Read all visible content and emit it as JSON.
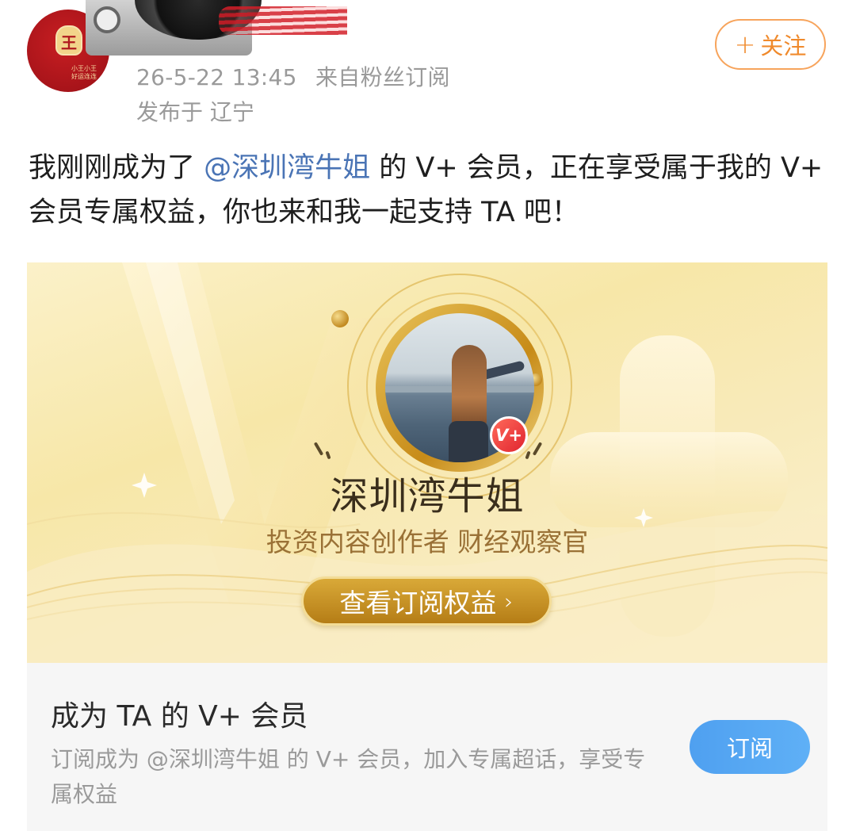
{
  "header": {
    "timestamp": "26-5-22 13:45",
    "source": "来自粉丝订阅",
    "location": "发布于 辽宁",
    "follow_plus": "+",
    "follow_label": "关注",
    "avatar_badge": "王",
    "avatar_tiny_text": "小王小王 好运连连"
  },
  "post": {
    "text_before": "我刚刚成为了",
    "mention": "@深圳湾牛姐",
    "text_after": " 的 V+ 会员，正在享受属于我的 V+ 会员专属权益，你也来和我一起支持 TA 吧！"
  },
  "card": {
    "vplus_badge": "V+",
    "name": "深圳湾牛姐",
    "description": "投资内容创作者 财经观察官",
    "button_label": "查看订阅权益",
    "button_chevron": "›"
  },
  "footer": {
    "title": "成为 TA 的 V+ 会员",
    "description": "订阅成为 @深圳湾牛姐 的 V+ 会员，加入专属超话，享受专属权益",
    "subscribe_label": "订阅"
  },
  "colors": {
    "follow_orange": "#f08a2c",
    "mention_blue": "#4a74b5",
    "gold": "#c78b18",
    "subscribe_blue": "#4fa0f0",
    "vbadge_red": "#e0242f"
  },
  "icons": [
    "plus-icon",
    "chevron-right-icon",
    "v-plus-badge-icon"
  ]
}
